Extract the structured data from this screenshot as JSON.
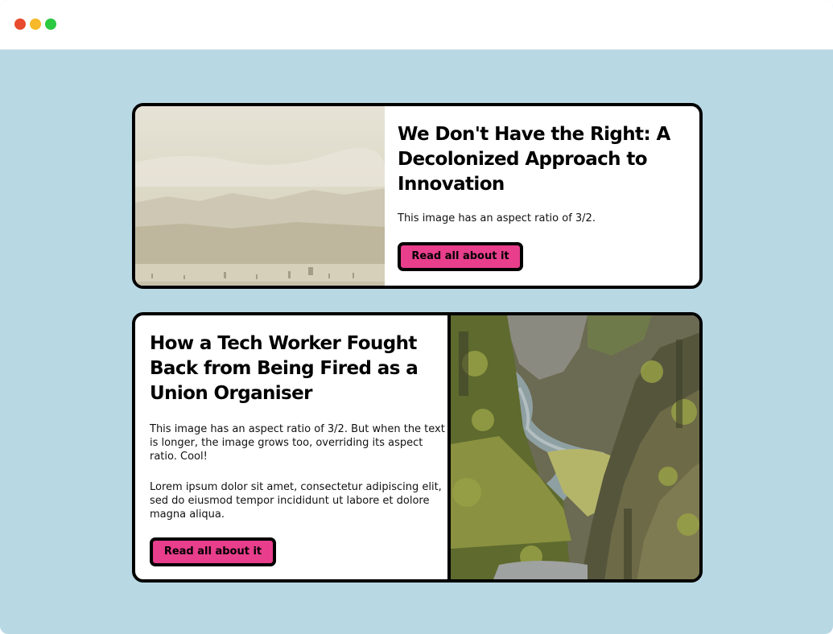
{
  "window": {
    "controls": {
      "close_color": "#e84a2e",
      "minimize_color": "#f5b92a",
      "maximize_color": "#2bc840"
    },
    "background": "#b8d8e4"
  },
  "cards": [
    {
      "title": "We Don't Have the Right: A Decolonized Approach to Innovation",
      "paragraphs": [
        "This image has an aspect ratio of 3/2."
      ],
      "button_label": "Read all about it",
      "image": "hazy-beach-landscape"
    },
    {
      "title": "How a Tech Worker Fought Back from Being Fired as a Union Organiser",
      "paragraphs": [
        "This image has an aspect ratio of 3/2. But when the text is longer, the image grows too, overriding its aspect ratio. Cool!",
        "Lorem ipsum dolor sit amet, consectetur adipiscing elit, sed do eiusmod tempor incididunt ut labore et dolore magna aliqua."
      ],
      "button_label": "Read all about it",
      "image": "mossy-canyon-river"
    }
  ],
  "accent_color": "#e83e8c"
}
